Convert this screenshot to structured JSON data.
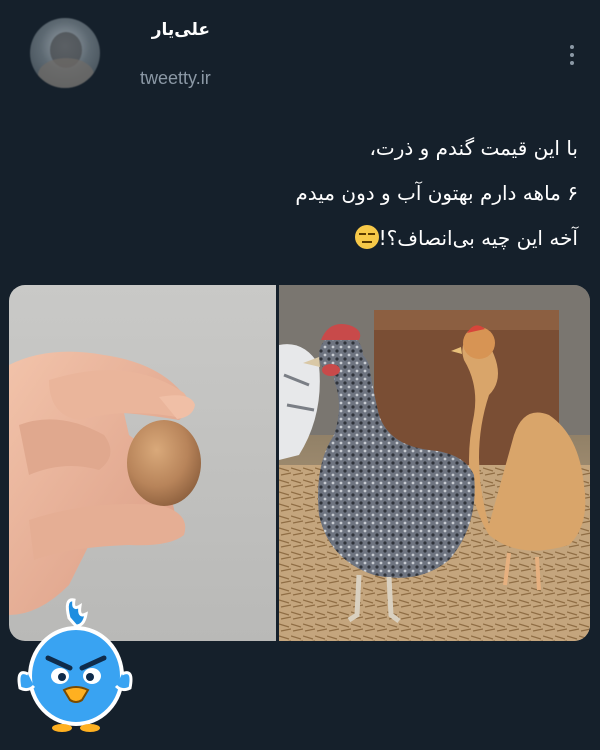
{
  "tweet": {
    "author": {
      "display_name": "علی‌یار",
      "handle": "tweetty.ir"
    },
    "text_lines": [
      "با این قیمت گندم و ذرت،",
      "۶ ماهه دارم بهتون آب و دون میدم",
      "آخه این چیه بی‌انصاف؟!"
    ],
    "emoji": "expressionless-face-emoji",
    "images": [
      {
        "name": "hand-holding-small-egg-photo"
      },
      {
        "name": "two-hens-photo"
      }
    ]
  },
  "colors": {
    "background": "#15202b",
    "primary_text": "#ffffff",
    "secondary_text": "#8b98a5"
  }
}
